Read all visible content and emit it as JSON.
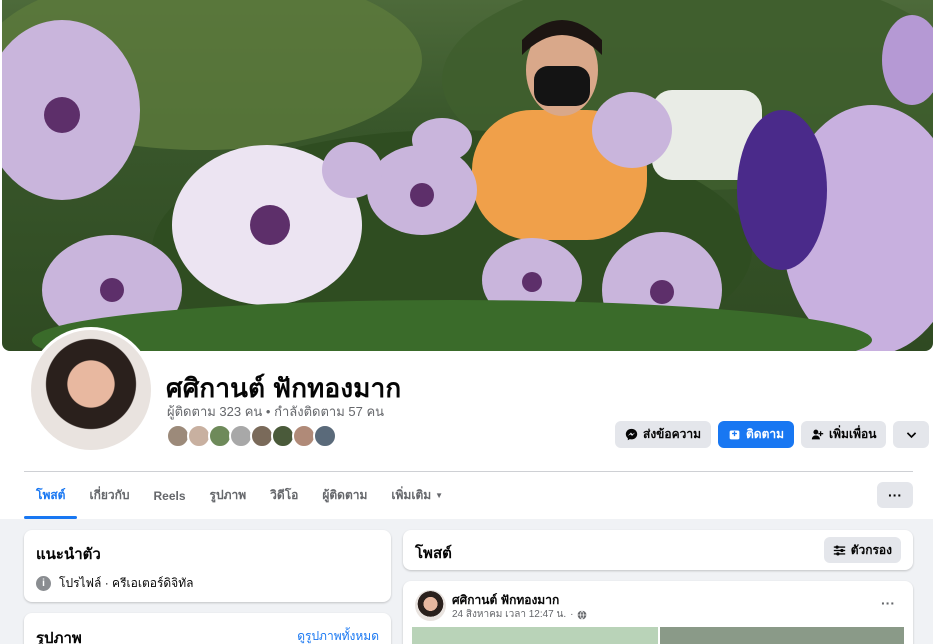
{
  "profile": {
    "name": "ศศิกานต์ ฟักทองมาก",
    "followers_text": "ผู้ติดตาม 323 คน • กำลังติดตาม 57 คน"
  },
  "actions": {
    "message": "ส่งข้อความ",
    "follow": "ติดตาม",
    "add_friend": "เพิ่มเพื่อน"
  },
  "tabs": [
    {
      "label": "โพสต์",
      "active": true
    },
    {
      "label": "เกี่ยวกับ"
    },
    {
      "label": "Reels"
    },
    {
      "label": "รูปภาพ"
    },
    {
      "label": "วิดีโอ"
    },
    {
      "label": "ผู้ติดตาม"
    },
    {
      "label": "เพิ่มเติม"
    }
  ],
  "intro": {
    "title": "แนะนำตัว",
    "info": "โปรไฟล์ · ครีเอเตอร์ดิจิทัล"
  },
  "photos": {
    "title": "รูปภาพ",
    "see_all": "ดูรูปภาพทั้งหมด"
  },
  "posts": {
    "title": "โพสต์",
    "filter": "ตัวกรอง",
    "items": [
      {
        "author": "ศศิกานต์ ฟักทองมาก",
        "time": "24 สิงหาคม เวลา 12:47 น."
      }
    ]
  },
  "colors": {
    "accent": "#1877f2",
    "secondary_button": "#e4e6eb",
    "page_bg": "#f0f2f5"
  },
  "icons": {
    "message": "messenger-icon",
    "follow": "follow-icon",
    "add_friend": "add-friend-icon",
    "more": "chevron-down-icon",
    "filter": "filter-icon",
    "privacy": "globe-icon"
  }
}
